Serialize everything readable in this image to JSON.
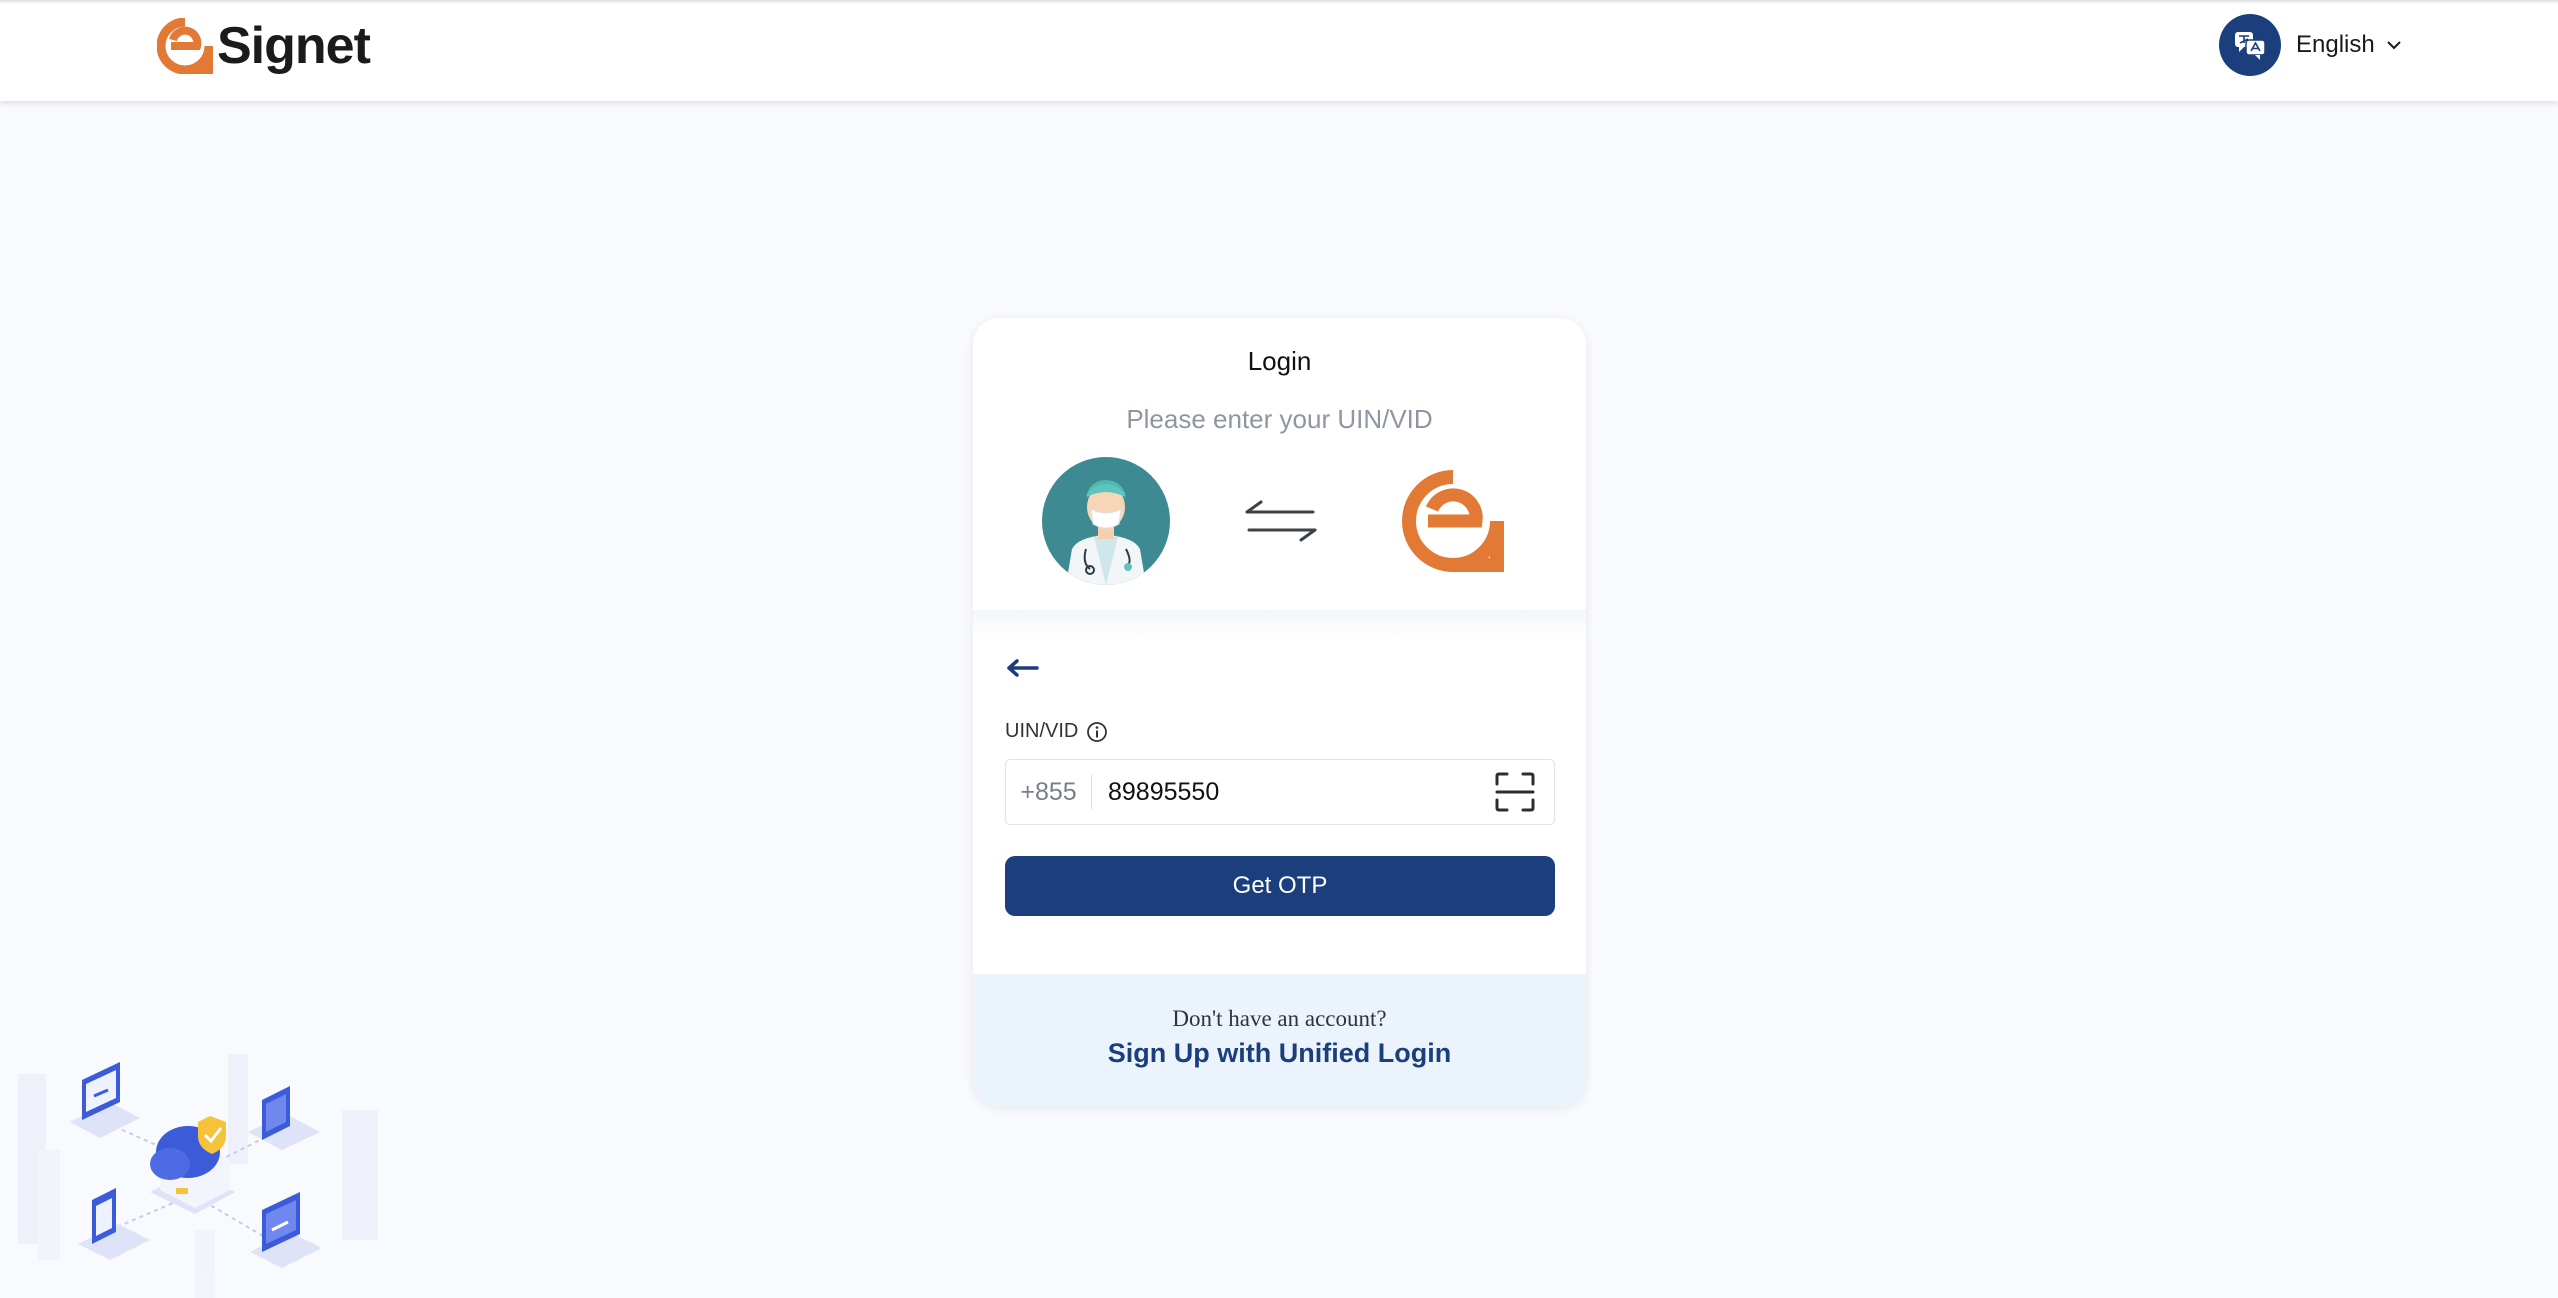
{
  "header": {
    "brand_name": "Signet",
    "language_label": "English"
  },
  "login": {
    "title": "Login",
    "subtitle": "Please enter your UIN/VID",
    "field_label": "UIN/VID",
    "country_code": "+855",
    "uin_value": "89895550",
    "otp_button": "Get OTP"
  },
  "footer": {
    "no_account_text": "Don't have an account?",
    "signup_link": "Sign Up with Unified Login"
  },
  "colors": {
    "primary": "#1b3f7c",
    "brand_orange": "#e27935",
    "footer_bg": "#ebf3fc",
    "page_bg": "#f9fafd"
  },
  "icons": [
    "signet-logo-icon",
    "language-icon",
    "chevron-down-icon",
    "doctor-avatar-icon",
    "swap-arrows-icon",
    "back-arrow-icon",
    "info-icon",
    "scan-icon"
  ]
}
